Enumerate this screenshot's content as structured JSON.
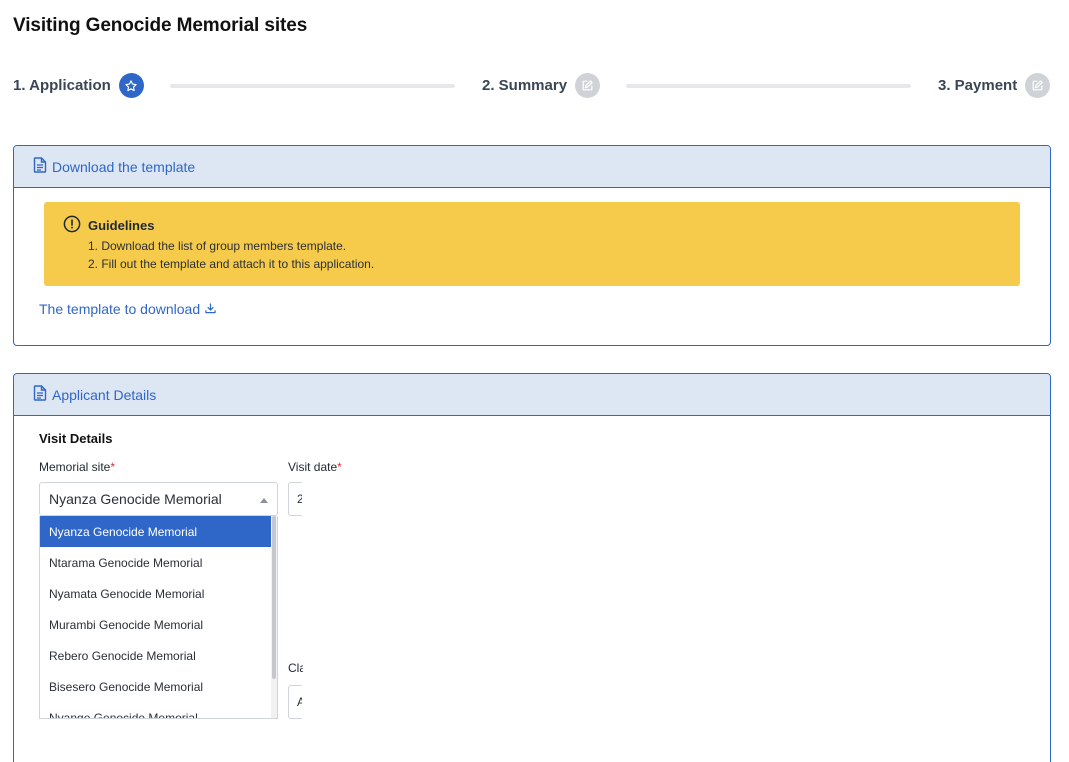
{
  "page": {
    "title": "Visiting Genocide Memorial sites"
  },
  "stepper": {
    "steps": [
      {
        "label": "1. Application",
        "icon": "star-icon",
        "state": "active"
      },
      {
        "label": "2. Summary",
        "icon": "edit-icon",
        "state": "inactive"
      },
      {
        "label": "3. Payment",
        "icon": "edit-icon",
        "state": "inactive"
      }
    ]
  },
  "template_panel": {
    "header_label": "Download the template",
    "header_icon": "document-icon",
    "guidelines": {
      "title": "Guidelines",
      "icon": "alert-circle-icon",
      "lines": [
        "1. Download the list of group members template.",
        "2. Fill out the template and attach it to this application."
      ]
    },
    "download_link": {
      "label": "The template to download",
      "icon": "download-icon"
    }
  },
  "applicant_panel": {
    "header_label": "Applicant Details",
    "header_icon": "document-icon",
    "section_title": "Visit Details",
    "memorial_site": {
      "label": "Memorial site",
      "required_mark": "*",
      "value": "Nyanza Genocide Memorial",
      "options": [
        "Nyanza Genocide Memorial",
        "Ntarama Genocide Memorial",
        "Nyamata Genocide Memorial",
        "Murambi Genocide Memorial",
        "Rebero Genocide Memorial",
        "Bisesero Genocide Memorial",
        "Nyange Genocide Memorial"
      ],
      "selected_index": 0
    },
    "visit_date": {
      "label": "Visit date",
      "required_mark": "*",
      "value_fragment": "2"
    },
    "partial_field": {
      "label_fragment": "Cla",
      "value_fragment": "A"
    }
  },
  "colors": {
    "accent": "#2f67c8",
    "panel_header_bg": "#dde6f3",
    "guidelines_bg": "#f6cb4b",
    "inactive_step": "#cfd3d8",
    "required": "#d0323c"
  }
}
